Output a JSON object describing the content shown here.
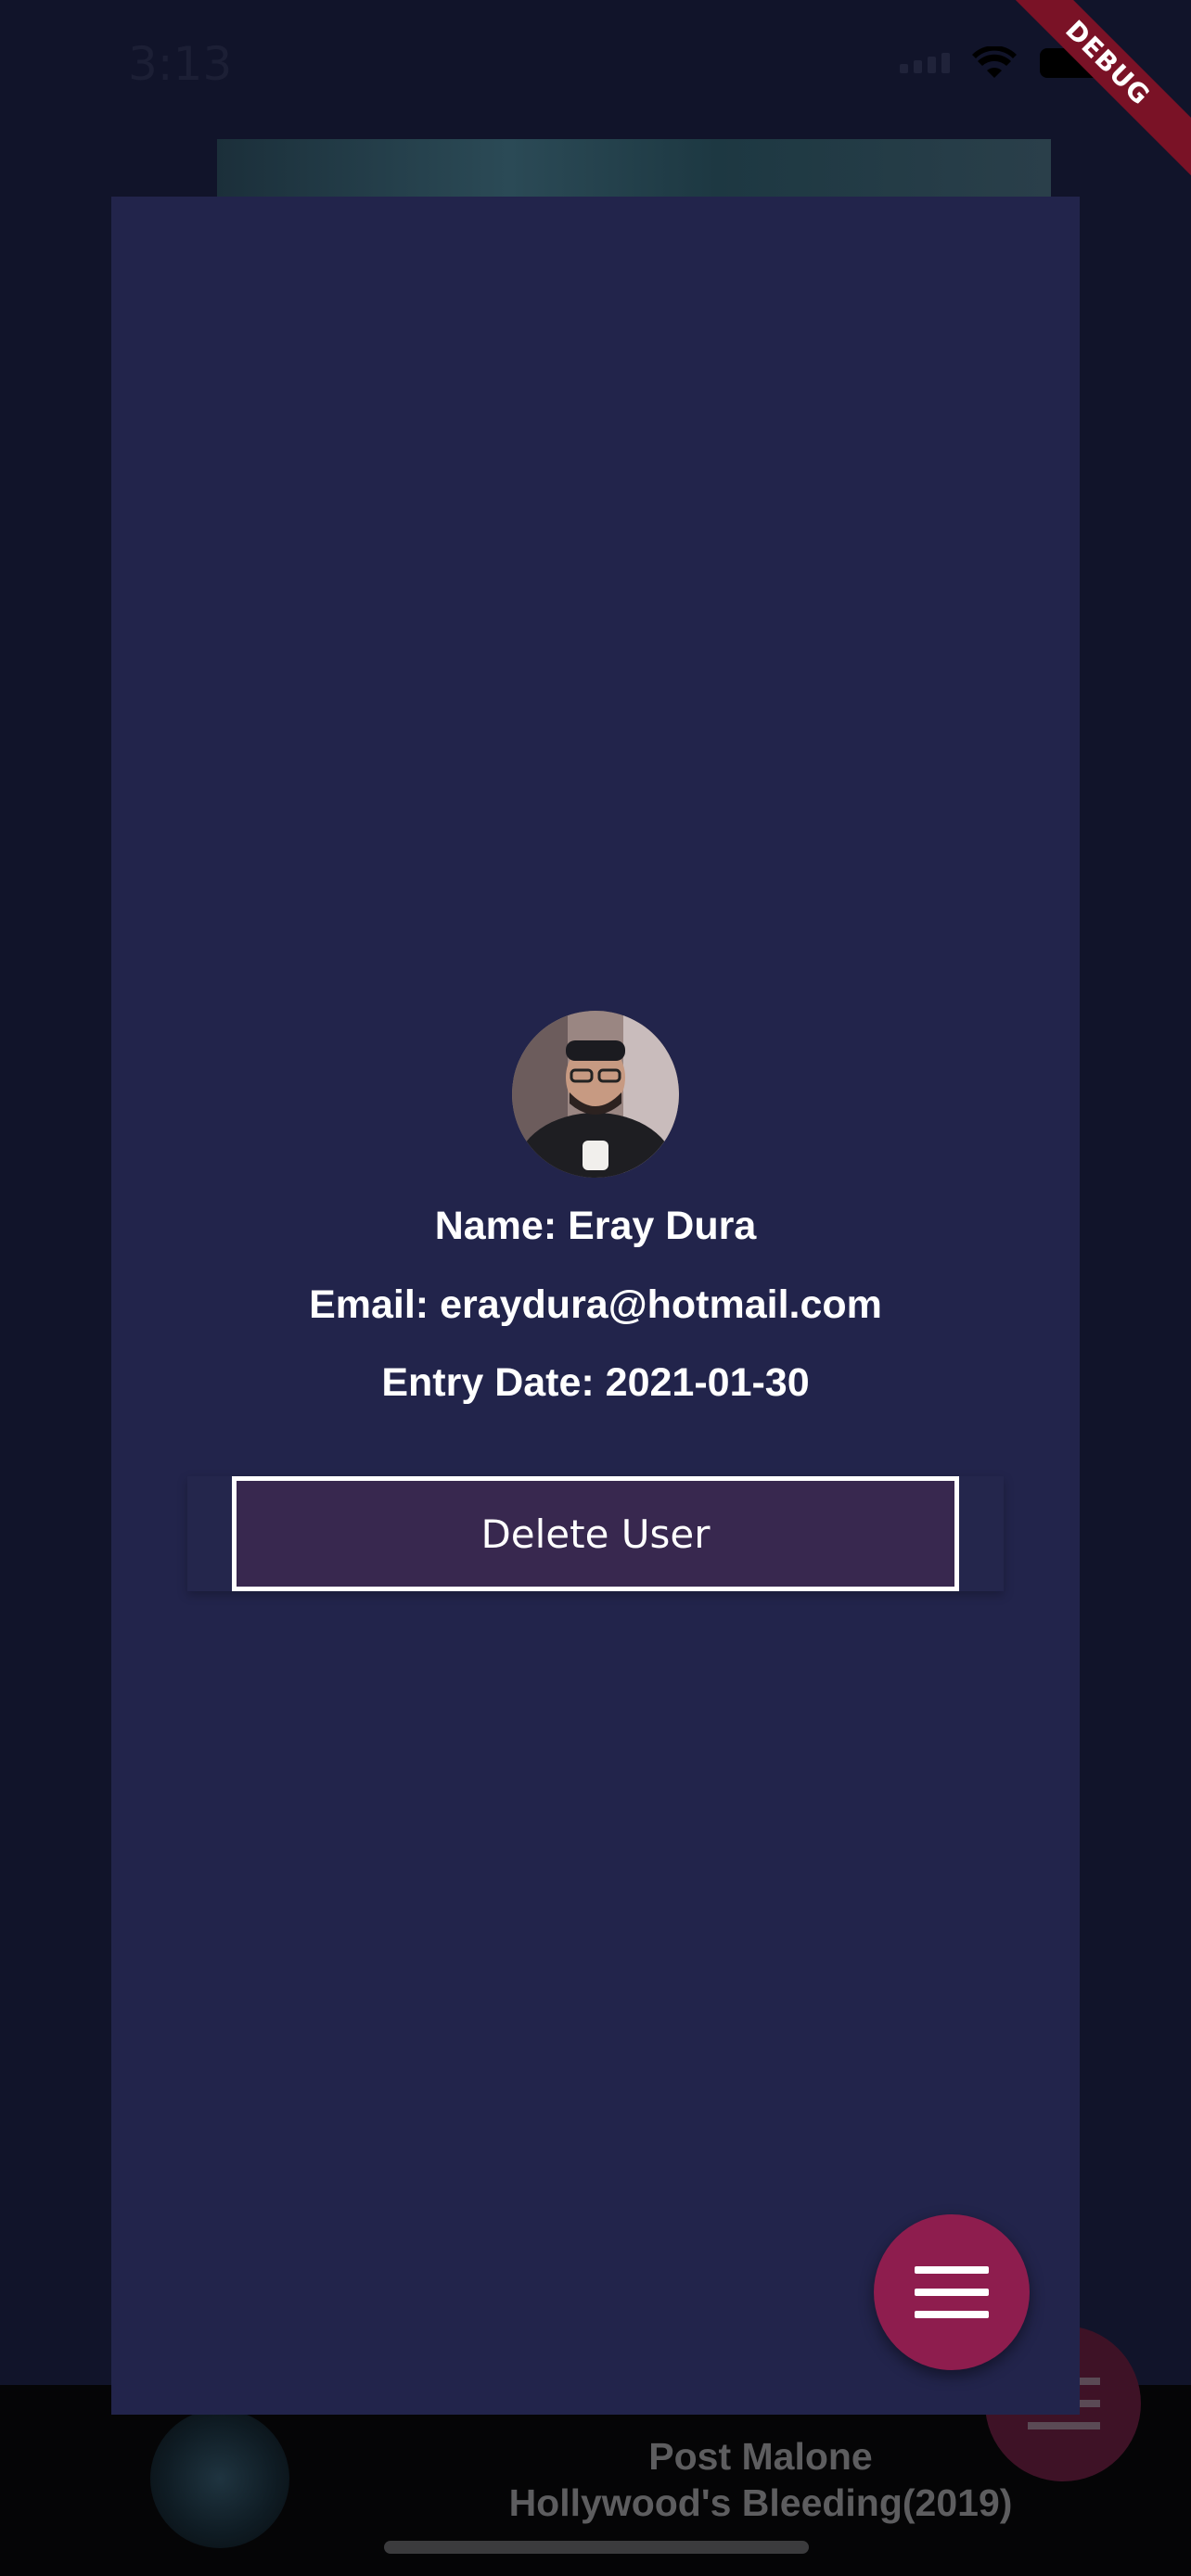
{
  "status_bar": {
    "time": "3:13"
  },
  "debug_banner": {
    "label": "DEBUG"
  },
  "profile": {
    "name_line": "Name: Eray Dura",
    "email_line": "Email: eraydura@hotmail.com",
    "entry_date_line": "Entry Date: 2021-01-30",
    "delete_label": "Delete User"
  },
  "fab": {
    "icon": "menu-icon"
  },
  "player": {
    "artist": "Post Malone",
    "album": "Hollywood's Bleeding(2019)"
  },
  "colors": {
    "background": "#11142a",
    "modal": "#22244b",
    "button_fill": "#38284f",
    "fab": "#8e1d4e",
    "debug_banner": "#7a1226"
  }
}
